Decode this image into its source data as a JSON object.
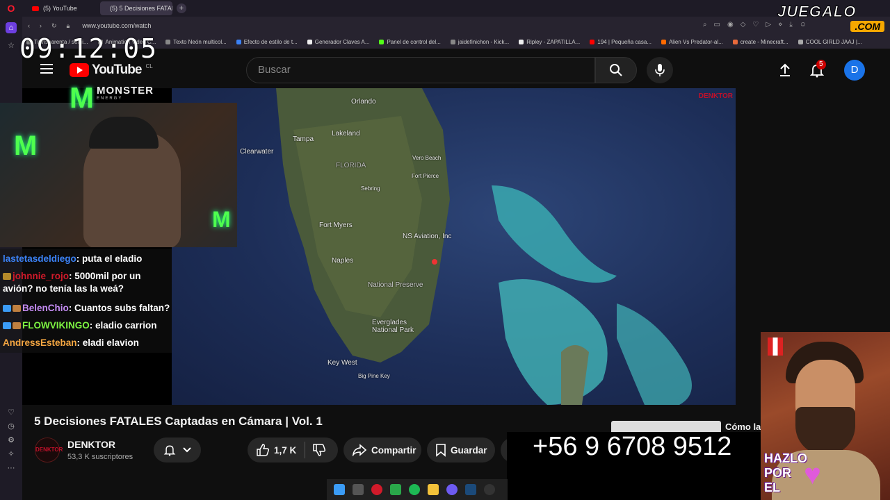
{
  "browser": {
    "tabs": [
      {
        "label": "(5) YouTube",
        "active": false
      },
      {
        "label": "(5) 5 Decisiones FATAL",
        "active": true
      }
    ],
    "url": "www.youtube.com/watch",
    "bookmarks": [
      "Transparenta / semi...",
      "Animation Video C...",
      "Texto Neón multicol...",
      "Efecto de estilo de t...",
      "Generador Claves A...",
      "Panel de control del...",
      "jaidefinichon - Kick...",
      "Ripley - ZAPATILLA...",
      "194 | Pequeña casa...",
      "Alien Vs Predator-al...",
      "create - Minecraft...",
      "COOL GIRLD JAAJ |..."
    ]
  },
  "overlay": {
    "clock": "09:12:05",
    "juegalo_top": "JUEGALO",
    "juegalo_bottom": ".COM",
    "monster_word": "MONSTER",
    "monster_sub": "ENERGY",
    "phone": "+56 9 6708 9512",
    "hazlo": "HAZLO POR EL"
  },
  "youtube": {
    "logo_text": "YouTube",
    "country_code": "CL",
    "search_placeholder": "Buscar",
    "notifications_count": "5",
    "avatar_letter": "D",
    "video_title": "5 Decisiones FATALES Captadas en Cámara | Vol. 1",
    "channel_name": "DENKTOR",
    "channel_subs": "53,3 K suscriptores",
    "channel_avatar_text": "DENKTOR",
    "likes": "1,7 K",
    "share_label": "Compartir",
    "save_label": "Guardar",
    "next_video_title": "Cómo la"
  },
  "video": {
    "watermark": "DENKTOR",
    "map_labels": [
      "Orlando",
      "Tampa",
      "Lakeland",
      "Clearwater",
      "FLORIDA",
      "Fort Myers",
      "NS Aviation, Inc",
      "Naples",
      "National Preserve",
      "Everglades National Park",
      "Key West",
      "Big Pine Key",
      "Fort Pierce",
      "Vero Beach",
      "Sebring"
    ]
  },
  "chat": [
    {
      "user": "lastetasdeldiego",
      "message": ": puta el eladio",
      "color": "#3b82f6"
    },
    {
      "user": "johnnie_rojo",
      "message": ": 5000mil por un avión? no tenía las la weá?",
      "color": "#d11a2a"
    },
    {
      "user": "BelenChio",
      "message": ": Cuantos subs faltan?",
      "color": "#c58cf5"
    },
    {
      "user": "FLOWVIKINGO",
      "message": ": eladio carrion",
      "color": "#7ef542"
    },
    {
      "user": "AndressEsteban",
      "message": ": eladi elavion",
      "color": "#f5a742"
    }
  ],
  "colors": {
    "yt_red": "#ff0000",
    "monster_green": "#4eff4e",
    "avatar_blue": "#1a73e8"
  }
}
